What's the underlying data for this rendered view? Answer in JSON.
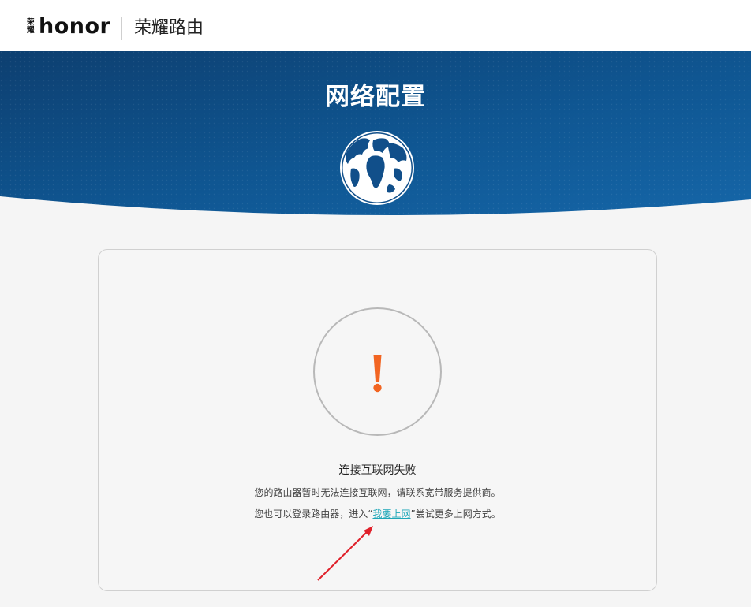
{
  "header": {
    "logo_cn": [
      "荣",
      "耀"
    ],
    "logo_en": "honor",
    "product_name": "荣耀路由"
  },
  "banner": {
    "title": "网络配置",
    "icon": "globe-icon"
  },
  "status": {
    "icon": "warning-icon",
    "icon_color": "#f26522",
    "title": "连接互联网失败",
    "line1": "您的路由器暂时无法连接互联网，请联系宽带服务提供商。",
    "line2_before": "您也可以登录路由器，进入“",
    "line2_link": "我要上网",
    "line2_after": "”尝试更多上网方式。"
  },
  "colors": {
    "banner_dark": "#0d3f70",
    "banner_light": "#1565a8",
    "link": "#1ea7b8",
    "warning": "#f26522",
    "annotation_arrow": "#e0212b"
  }
}
